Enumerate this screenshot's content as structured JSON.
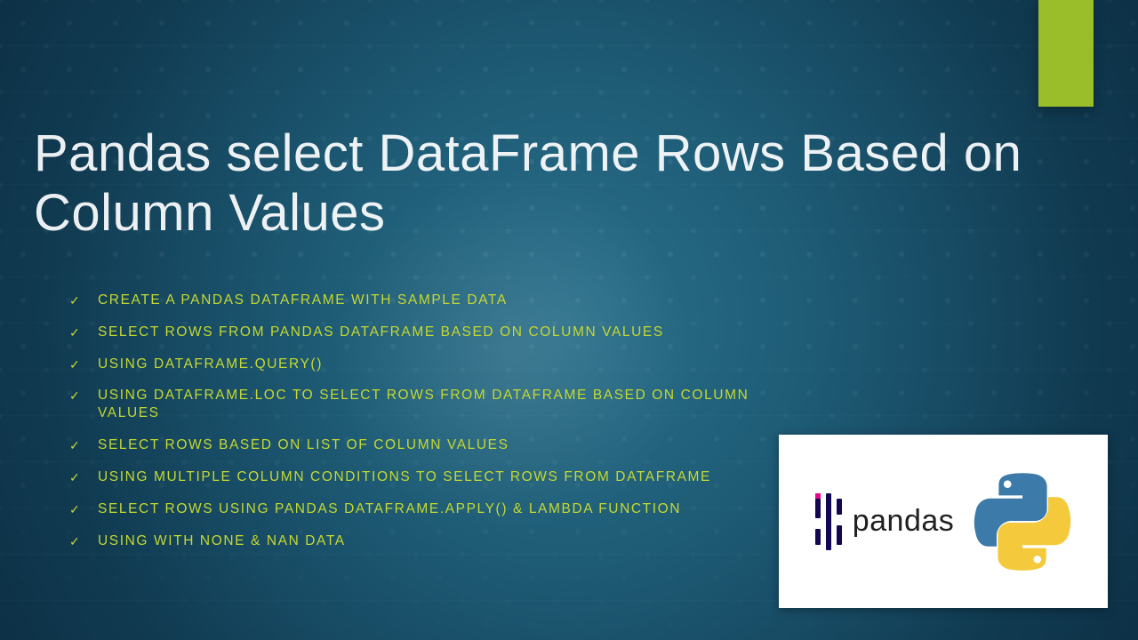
{
  "title": "Pandas select DataFrame Rows Based on Column Values",
  "accent_color": "#9ABE2A",
  "bullet_color": "#C5D92F",
  "bullets": [
    "CREATE A PANDAS DATAFRAME WITH SAMPLE DATA",
    "SELECT ROWS FROM PANDAS DATAFRAME BASED ON COLUMN VALUES",
    "USING DATAFRAME.QUERY()",
    "USING DATAFRAME.LOC TO SELECT ROWS FROM DATAFRAME BASED ON COLUMN VALUES",
    " SELECT ROWS BASED ON LIST OF COLUMN VALUES",
    "USING MULTIPLE COLUMN CONDITIONS TO SELECT ROWS FROM DATAFRAME",
    "SELECT ROWS USING PANDAS DATAFRAME.APPLY() & LAMBDA FUNCTION",
    "USING WITH NONE & NAN DATA"
  ],
  "checkmark_glyph": "✓",
  "logo": {
    "pandas_text": "pandas",
    "pandas_label": "pandas-logo",
    "python_label": "python-logo"
  }
}
